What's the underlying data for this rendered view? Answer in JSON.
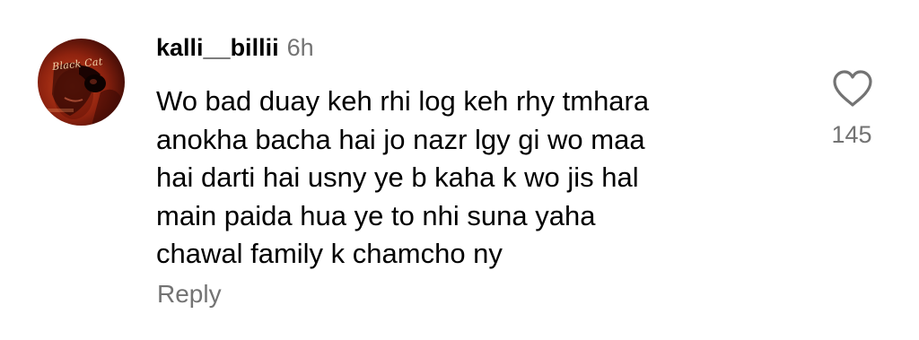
{
  "comment": {
    "avatar": {
      "label": "Black Cat"
    },
    "username": "kalli__billii",
    "time": "6h",
    "text_lines": [
      "Wo bad duay keh rhi log keh rhy tmhara",
      "anokha bacha hai jo nazr lgy gi wo maa",
      "hai darti hai usny ye b kaha k wo jis hal",
      "main paida hua ye to nhi suna yaha",
      "chawal family k chamcho ny"
    ],
    "reply_label": "Reply",
    "like": {
      "icon": "heart-outline-icon",
      "count": "145"
    }
  }
}
